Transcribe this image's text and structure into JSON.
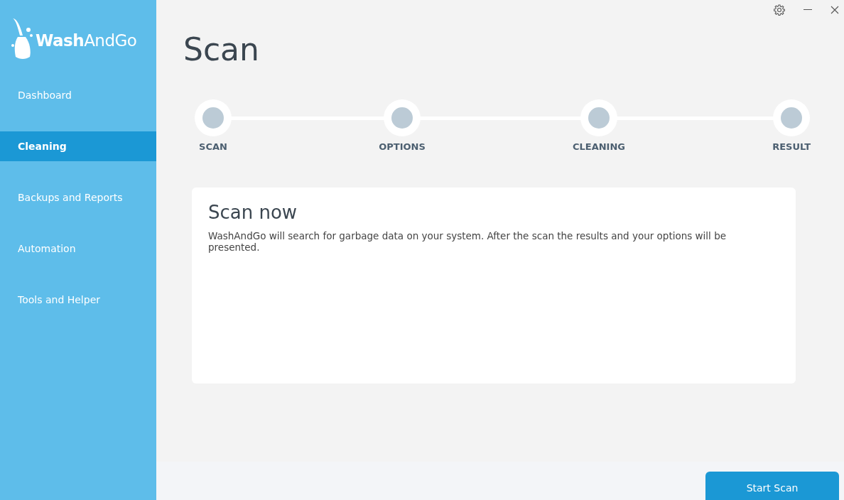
{
  "app": {
    "logo": "**Wash**AndGo"
  },
  "sidebar": {
    "items": [
      {
        "label": "Dashboard",
        "selected": false
      },
      {
        "label": "Cleaning",
        "selected": true
      },
      {
        "label": "Backups and Reports",
        "selected": false
      },
      {
        "label": "Automation",
        "selected": false
      },
      {
        "label": "Tools and Helper",
        "selected": false
      }
    ]
  },
  "page": {
    "title": "Scan"
  },
  "steps": [
    {
      "label": "SCAN"
    },
    {
      "label": "OPTIONS"
    },
    {
      "label": "CLEANING"
    },
    {
      "label": "RESULT"
    }
  ],
  "card": {
    "title": "Scan now",
    "text": "WashAndGo will search for garbage data on your system. After the scan the results and your options will be presented."
  },
  "footer": {
    "button": "Start Scan"
  }
}
